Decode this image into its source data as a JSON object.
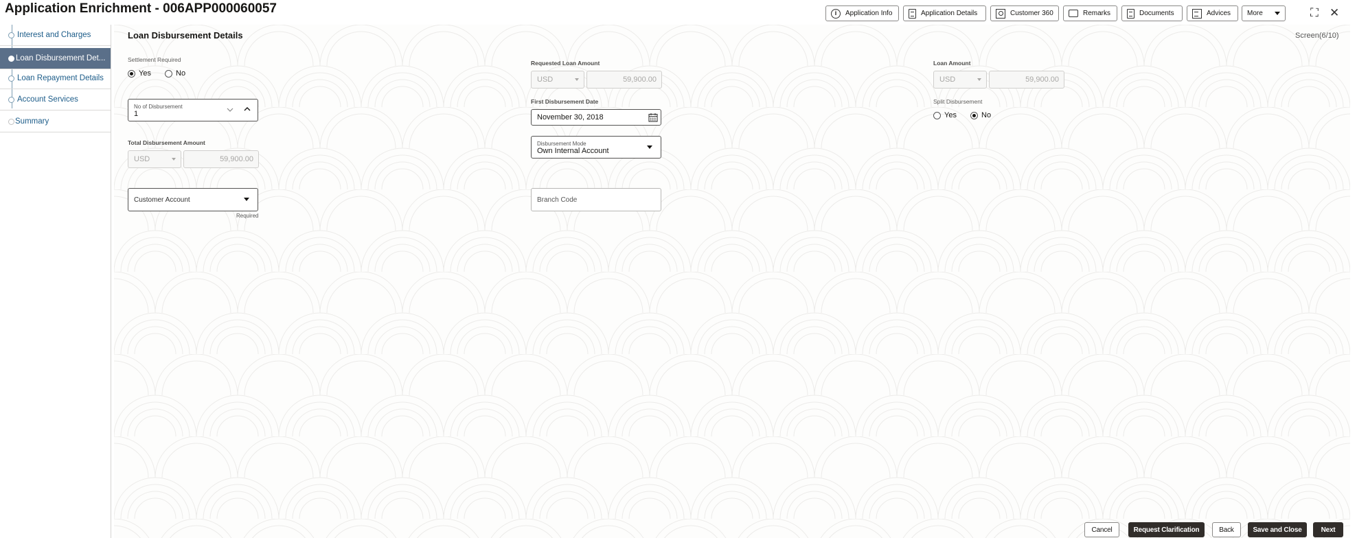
{
  "header": {
    "title": "Application Enrichment - 006APP000060057",
    "buttons": [
      {
        "label": "Application Info",
        "icon": "info-icon"
      },
      {
        "label": "Application Details",
        "icon": "document-icon"
      },
      {
        "label": "Customer 360",
        "icon": "customer-icon"
      },
      {
        "label": "Remarks",
        "icon": "chat-icon"
      },
      {
        "label": "Documents",
        "icon": "document-icon"
      },
      {
        "label": "Advices",
        "icon": "advices-icon"
      },
      {
        "label": "More",
        "icon": "chevron-down-icon"
      }
    ],
    "expand_glyph": "⛶",
    "close_glyph": "✕"
  },
  "sidebar": {
    "items": [
      {
        "label": "Interest and Charges"
      },
      {
        "label": "Loan Disbursement Det..."
      },
      {
        "label": "Loan Repayment Details"
      },
      {
        "label": "Account Services"
      },
      {
        "label": "Summary"
      }
    ]
  },
  "main": {
    "section_title": "Loan Disbursement Details",
    "screen_indicator": "Screen(6/10)",
    "settlement": {
      "label": "Settlement Required",
      "yes": "Yes",
      "no": "No",
      "selected": "Yes"
    },
    "requested_loan_amount": {
      "label": "Requested Loan Amount",
      "currency": "USD",
      "value": "59,900.00"
    },
    "loan_amount": {
      "label": "Loan Amount",
      "currency": "USD",
      "value": "59,900.00"
    },
    "no_of_disbursement": {
      "label": "No of Disbursement",
      "value": "1"
    },
    "first_disbursement_date": {
      "label": "First Disbursement Date",
      "value": "November 30, 2018"
    },
    "split_disbursement": {
      "label": "Split Disbursement",
      "yes": "Yes",
      "no": "No",
      "selected": "No"
    },
    "total_disbursement_amount": {
      "label": "Total Disbursement Amount",
      "currency": "USD",
      "value": "59,900.00"
    },
    "disbursement_mode": {
      "label": "Disbursement Mode",
      "value": "Own Internal Account"
    },
    "customer_account": {
      "placeholder": "Customer Account",
      "hint": "Required"
    },
    "branch_code": {
      "placeholder": "Branch Code"
    }
  },
  "footer": {
    "cancel": "Cancel",
    "request_clarification": "Request Clarification",
    "back": "Back",
    "save_and_close": "Save and Close",
    "next": "Next"
  },
  "colors": {
    "active_nav_bg": "#5a6f89",
    "nav_link": "#1c5c89",
    "primary_button": "#312d2a"
  }
}
